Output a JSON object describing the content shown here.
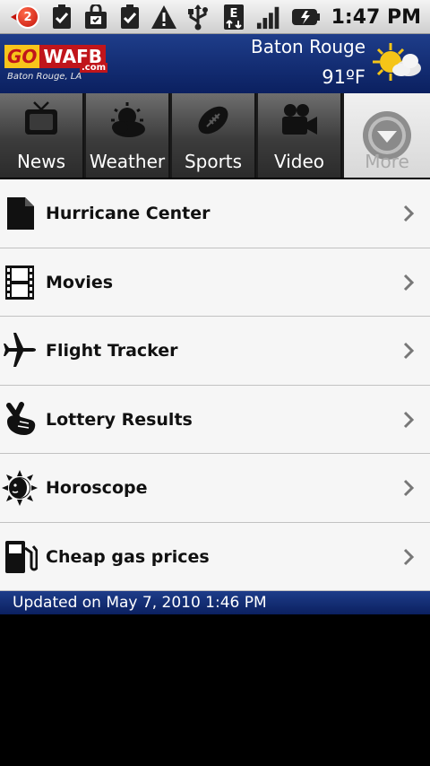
{
  "status_bar": {
    "notification_count": "2",
    "time": "1:47 PM",
    "left_icons": [
      "clipboard-check-icon",
      "bag-icon",
      "clipboard-check-icon",
      "warning-icon",
      "usb-icon"
    ],
    "right_icons": [
      "edge-data-icon",
      "signal-icon",
      "battery-charging-icon"
    ]
  },
  "header": {
    "logo_go": "GO",
    "logo_wafb": "WAFB",
    "logo_com": ".com",
    "logo_city": "Baton Rouge, LA",
    "city": "Baton Rouge",
    "temperature": "91ºF",
    "weather_icon": "partly-cloudy-icon"
  },
  "tabs": [
    {
      "label": "News",
      "icon": "tv-icon"
    },
    {
      "label": "Weather",
      "icon": "weather-icon"
    },
    {
      "label": "Sports",
      "icon": "football-icon"
    },
    {
      "label": "Video",
      "icon": "video-camera-icon"
    },
    {
      "label": "More",
      "icon": "chevron-down-circle-icon"
    }
  ],
  "menu": [
    {
      "label": "Hurricane Center",
      "icon": "document-icon"
    },
    {
      "label": "Movies",
      "icon": "film-icon"
    },
    {
      "label": "Flight Tracker",
      "icon": "airplane-icon"
    },
    {
      "label": "Lottery Results",
      "icon": "crossed-fingers-icon"
    },
    {
      "label": "Horoscope",
      "icon": "sun-moon-icon"
    },
    {
      "label": "Cheap gas prices",
      "icon": "gas-pump-icon"
    }
  ],
  "footer": {
    "updated": "Updated on May 7, 2010 1:46 PM"
  },
  "colors": {
    "header_blue": "#0b2060",
    "logo_yellow": "#f7c51b",
    "logo_red": "#c0151b",
    "list_bg": "#f6f6f6"
  }
}
